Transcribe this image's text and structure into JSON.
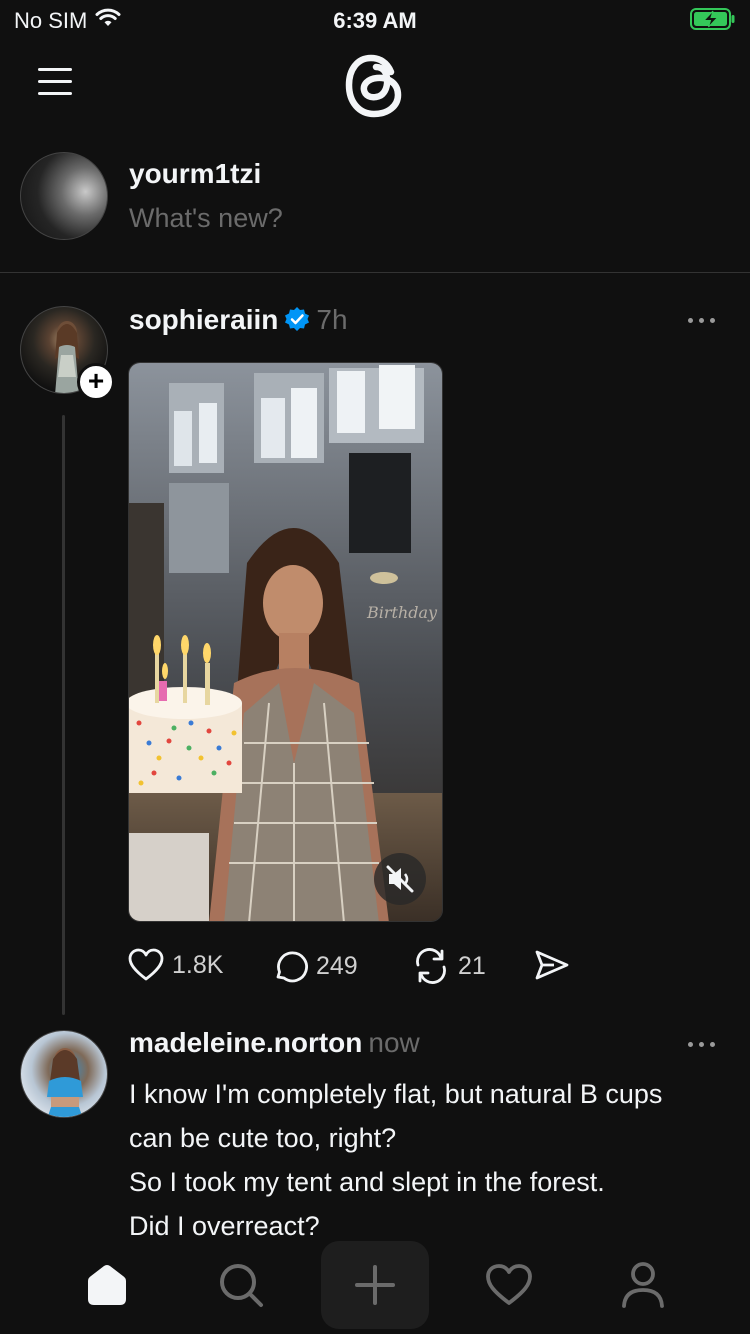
{
  "status_bar": {
    "carrier": "No SIM",
    "time": "6:39 AM"
  },
  "composer": {
    "username": "yourm1tzi",
    "placeholder": "What's new?"
  },
  "posts": [
    {
      "username": "sophieraiin",
      "verified": true,
      "time": "7h",
      "media_text": "Birthday",
      "stats": {
        "likes": "1.8K",
        "replies": "249",
        "reposts": "21"
      }
    },
    {
      "username": "madeleine.norton",
      "time": "now",
      "text": "I know I'm completely flat, but natural B cups can be cute too, right?",
      "text2": "So I took my tent and slept in the forest.",
      "text3": "Did I overreact?"
    }
  ],
  "tab_bar": {
    "icons": [
      "home-icon",
      "search-icon",
      "create-icon",
      "activity-icon",
      "profile-icon"
    ]
  },
  "colors": {
    "background": "#101010",
    "text": "#f3f5f7",
    "muted": "#6b6b6b",
    "verified": "#0095f6",
    "battery": "#34c759"
  }
}
